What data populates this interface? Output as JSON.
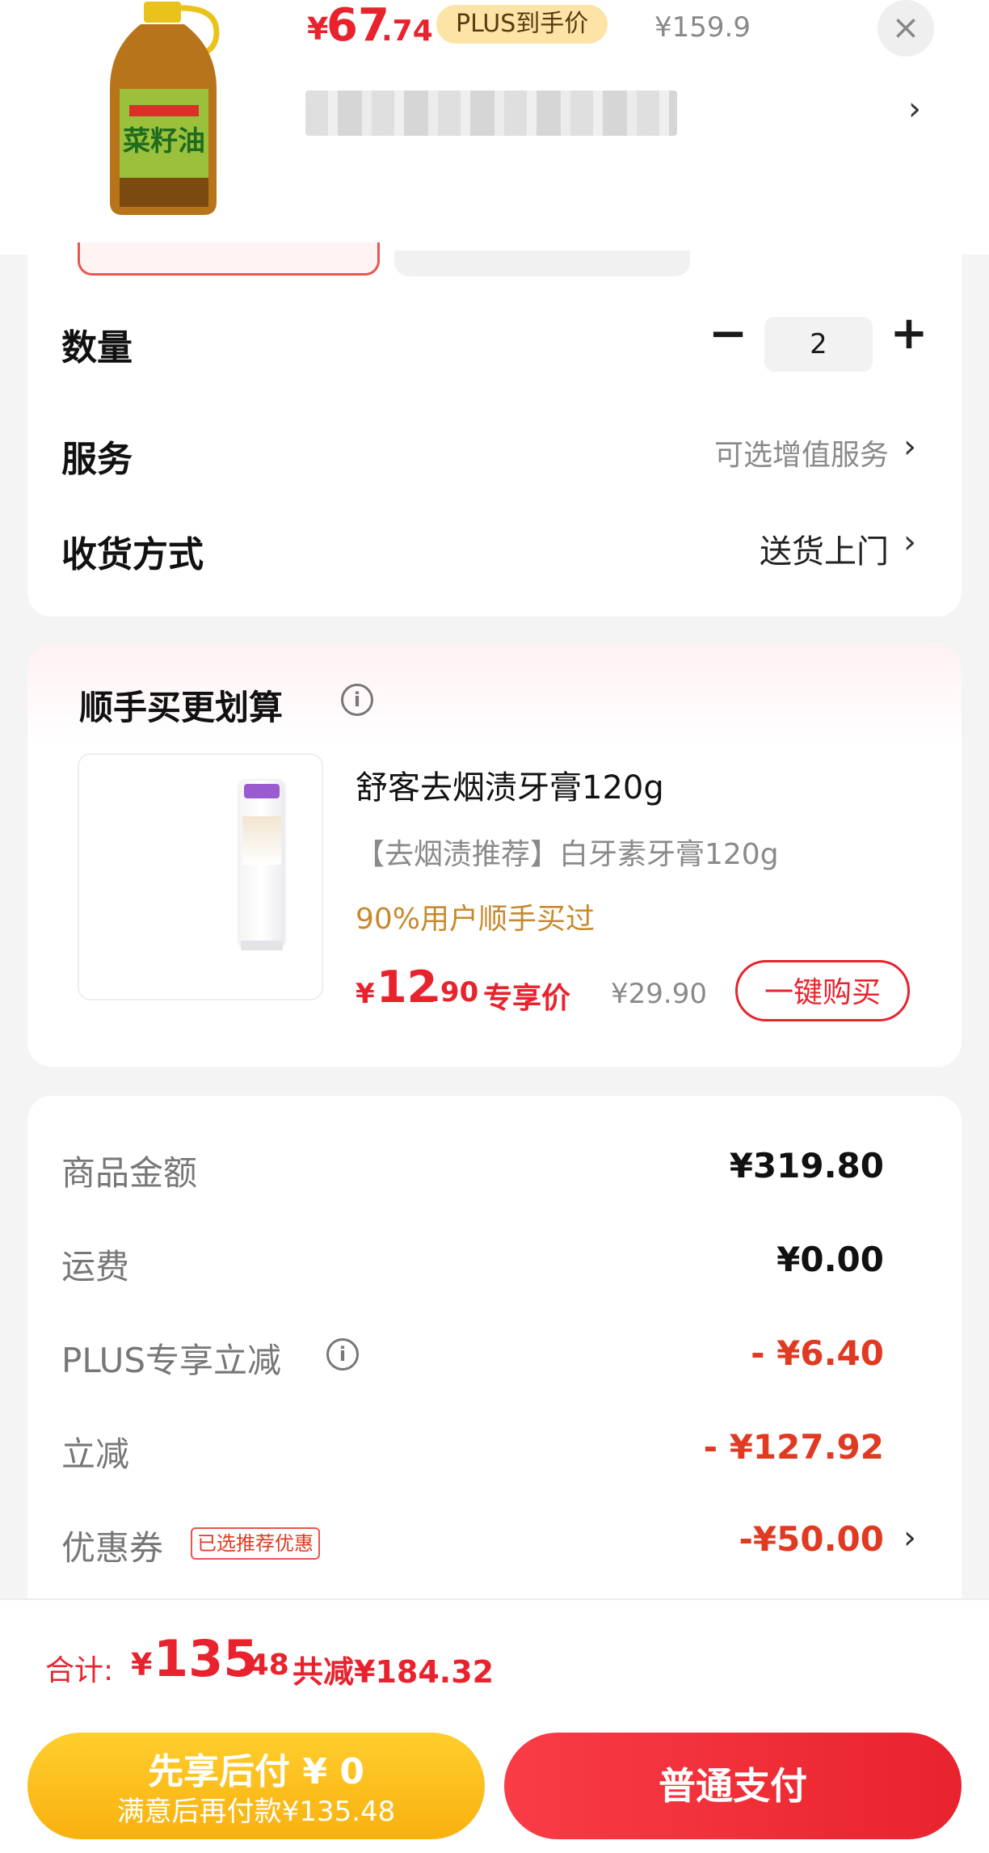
{
  "product": {
    "price_symbol": "¥",
    "price_int": "67",
    "price_dec": ".74",
    "plus_badge": "PLUS到手价",
    "original_price": "¥159.9",
    "close_icon": "×",
    "chevron": "›"
  },
  "spec": {
    "quantity_label": "数量",
    "quantity_minus": "−",
    "quantity_value": "2",
    "quantity_plus": "+",
    "service_label": "服务",
    "service_value": "可选增值服务",
    "delivery_label": "收货方式",
    "delivery_value": "送货上门",
    "chevron": "›"
  },
  "recommend": {
    "title": "顺手买更划算",
    "info_icon": "i",
    "item_name": "舒客去烟渍牙膏120g",
    "item_subtitle": "【去烟渍推荐】白牙素牙膏120g",
    "social_proof": "90%用户顺手买过",
    "price_symbol": "¥",
    "price_int": "12",
    "price_dec": ".90",
    "price_tag": "专享价",
    "original_price": "¥29.90",
    "buy_button": "一键购买"
  },
  "summary": {
    "goods_label": "商品金额",
    "goods_value": "¥319.80",
    "shipping_label": "运费",
    "shipping_value": "¥0.00",
    "plus_label": "PLUS专享立减",
    "plus_info_icon": "i",
    "plus_value": "- ¥6.40",
    "discount_label": "立减",
    "discount_value": "- ¥127.92",
    "coupon_label": "优惠券",
    "coupon_tag": "已选推荐优惠",
    "coupon_value": "-¥50.00",
    "chevron": "›"
  },
  "total": {
    "label": "合计:",
    "symbol": "¥",
    "int": "135",
    "dec": ".48",
    "saved": "共减¥184.32"
  },
  "actions": {
    "pay_later_title": "先享后付 ¥ 0",
    "pay_later_sub": "满意后再付款¥135.48",
    "pay_normal": "普通支付"
  },
  "colors": {
    "accent_red": "#e8232d",
    "pay_later_yellow": "#f8b10f",
    "plus_badge_bg": "#fbe4a6",
    "social_proof": "#c8892e"
  }
}
